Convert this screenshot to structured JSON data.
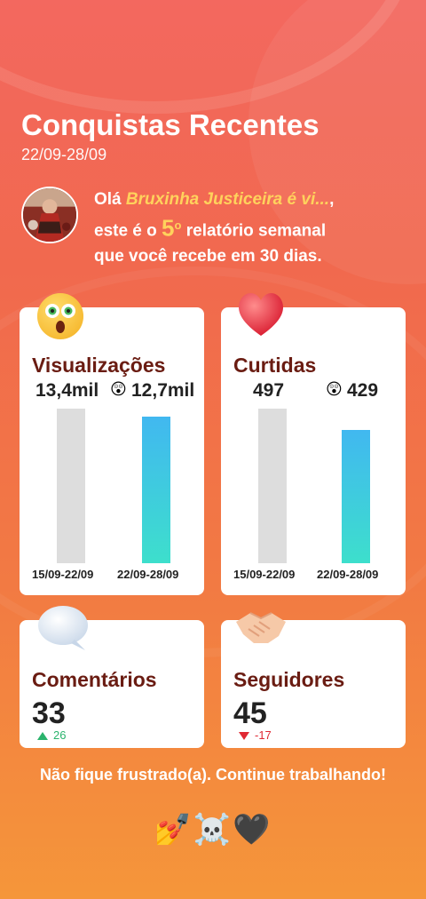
{
  "header": {
    "title": "Conquistas Recentes",
    "date_range": "22/09-28/09"
  },
  "greeting": {
    "prefix": "Olá ",
    "name": "Bruxinha Justiceira é vi...",
    "suffix_line1": ",",
    "line2_before": "este é o ",
    "report_number": "5",
    "ordinal": "o",
    "line2_after": " relatório semanal",
    "line3": "que você recebe em 30 dias."
  },
  "cards": {
    "views": {
      "title": "Visualizações",
      "prev_value": "13,4mil",
      "curr_value": "12,7mil",
      "prev_label": "15/09-22/09",
      "curr_label": "22/09-28/09"
    },
    "likes": {
      "title": "Curtidas",
      "prev_value": "497",
      "curr_value": "429",
      "prev_label": "15/09-22/09",
      "curr_label": "22/09-28/09"
    },
    "comments": {
      "title": "Comentários",
      "value": "33",
      "delta": "26",
      "direction": "up"
    },
    "followers": {
      "title": "Seguidores",
      "value": "45",
      "delta": "-17",
      "direction": "down"
    }
  },
  "chart_data": [
    {
      "type": "bar",
      "title": "Visualizações",
      "categories": [
        "15/09-22/09",
        "22/09-28/09"
      ],
      "values": [
        13400,
        12700
      ]
    },
    {
      "type": "bar",
      "title": "Curtidas",
      "categories": [
        "15/09-22/09",
        "22/09-28/09"
      ],
      "values": [
        497,
        429
      ]
    }
  ],
  "footer": {
    "message": "Não fique frustrado(a). Continue trabalhando!",
    "emojis": "💅☠️🖤"
  },
  "emoji_face": "😲",
  "colors": {
    "title_dark": "#6a1c12",
    "accent_yellow": "#ffd25c",
    "up": "#2ab36c",
    "down": "#e02933",
    "bar_prev": "#dddddd",
    "bar_curr_top": "#41b8f0",
    "bar_curr_bottom": "#3ddfcc"
  }
}
